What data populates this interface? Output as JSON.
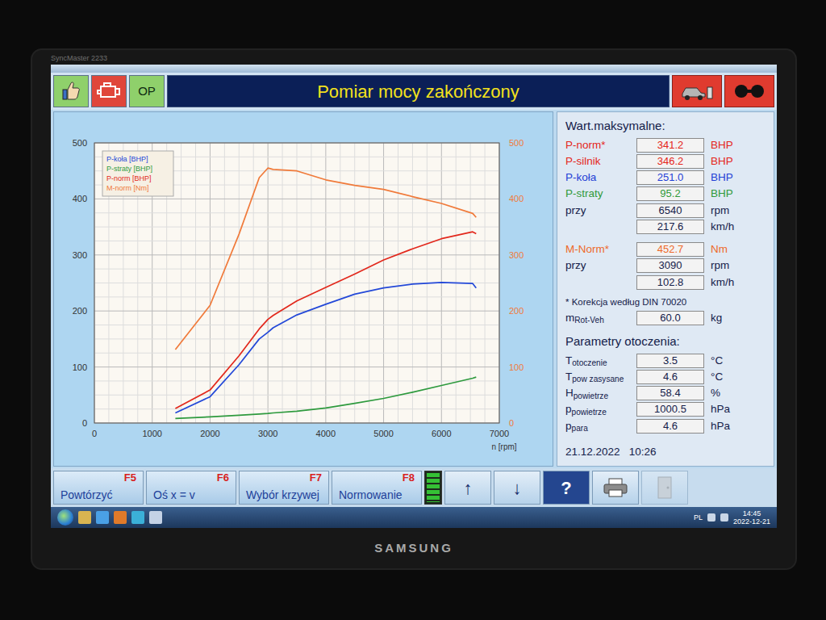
{
  "monitor": {
    "brand": "SAMSUNG",
    "model": "SyncMaster 2233"
  },
  "header": {
    "title": "Pomiar mocy zakończony",
    "status": [
      {
        "label": "OP"
      }
    ]
  },
  "chart": {
    "x_axis": {
      "label": "n [rpm]",
      "ticks": [
        "0",
        "1000",
        "2000",
        "3000",
        "4000",
        "5000",
        "6000",
        "7000"
      ]
    },
    "y_left": {
      "ticks": [
        "0",
        "100",
        "200",
        "300",
        "400",
        "500"
      ]
    },
    "y_right": {
      "ticks": [
        "0",
        "100",
        "200",
        "300",
        "400",
        "500"
      ]
    },
    "rpm": [
      1400,
      2000,
      2500,
      2850,
      3000,
      3090,
      3500,
      4000,
      4500,
      5000,
      5500,
      6000,
      6540,
      6600
    ],
    "series": [
      {
        "name": "P-koła [BHP]",
        "axis": "left",
        "color": "#2348d8",
        "values": [
          18,
          47,
          104,
          150,
          162,
          170,
          193,
          212,
          230,
          241,
          248,
          251,
          249,
          241
        ]
      },
      {
        "name": "P-straty [BHP]",
        "axis": "left",
        "color": "#2e9a3e",
        "values": [
          8,
          11,
          14,
          16,
          17,
          18,
          21,
          27,
          35,
          44,
          55,
          67,
          80,
          82
        ]
      },
      {
        "name": "P-norm [BHP]",
        "axis": "left",
        "color": "#e2281c",
        "values": [
          26,
          59,
          120,
          168,
          185,
          192,
          218,
          242,
          266,
          291,
          311,
          329,
          341.2,
          338
        ]
      },
      {
        "name": "M-norm [Nm]",
        "axis": "right",
        "color": "#f07a3a",
        "values": [
          131,
          210,
          337,
          438,
          455,
          452.7,
          450,
          434,
          424,
          417,
          404,
          392,
          374,
          367
        ]
      }
    ]
  },
  "max_values": {
    "title": "Wart.maksymalne:",
    "power_rows": [
      {
        "label": "P-norm*",
        "value": "341.2",
        "unit": "BHP",
        "color": "#e5261a"
      },
      {
        "label": "P-silnik",
        "value": "346.2",
        "unit": "BHP",
        "color": "#e5261a"
      },
      {
        "label": "P-koła",
        "value": "251.0",
        "unit": "BHP",
        "color": "#1f3fd6"
      },
      {
        "label": "P-straty",
        "value": "95.2",
        "unit": "BHP",
        "color": "#2f9a3a"
      },
      {
        "label": "przy",
        "value": "6540",
        "unit": "rpm",
        "color": "#14204a"
      },
      {
        "label": "",
        "value": "217.6",
        "unit": "km/h",
        "color": "#14204a"
      }
    ],
    "torque_rows": [
      {
        "label": "M-Norm*",
        "value": "452.7",
        "unit": "Nm",
        "color": "#ee6a2a"
      },
      {
        "label": "przy",
        "value": "3090",
        "unit": "rpm",
        "color": "#14204a"
      },
      {
        "label": "",
        "value": "102.8",
        "unit": "km/h",
        "color": "#14204a"
      }
    ],
    "note": "* Korekcja według DIN 70020",
    "mass": {
      "symbol": "m",
      "sub": "Rot-Veh",
      "value": "60.0",
      "unit": "kg"
    }
  },
  "ambient": {
    "title": "Parametry otoczenia:",
    "rows": [
      {
        "symbol": "T",
        "sub": "otoczenie",
        "value": "3.5",
        "unit": "°C"
      },
      {
        "symbol": "T",
        "sub": "pow zasysane",
        "value": "4.6",
        "unit": "°C"
      },
      {
        "symbol": "H",
        "sub": "powietrze",
        "value": "58.4",
        "unit": "%"
      },
      {
        "symbol": "p",
        "sub": "powietrze",
        "value": "1000.5",
        "unit": "hPa"
      },
      {
        "symbol": "p",
        "sub": "para",
        "value": "4.6",
        "unit": "hPa"
      }
    ]
  },
  "timestamp": "21.12.2022   10:26",
  "function_keys": [
    {
      "label": "Powtórzyć",
      "key": "F5"
    },
    {
      "label": "Oś x = v",
      "key": "F6"
    },
    {
      "label": "Wybór krzywej",
      "key": "F7"
    },
    {
      "label": "Normowanie",
      "key": "F8"
    }
  ],
  "battery": {
    "level": 1
  },
  "nav_buttons": [
    {
      "label": "↑",
      "kind": "arrow"
    },
    {
      "label": "↓",
      "kind": "arrow"
    },
    {
      "label": "?",
      "kind": "help"
    }
  ],
  "icon_buttons": [
    {
      "disabled": false
    },
    {
      "disabled": true
    }
  ],
  "taskbar": {
    "language": "PL",
    "time": "14:45",
    "date": "2022-12-21"
  }
}
